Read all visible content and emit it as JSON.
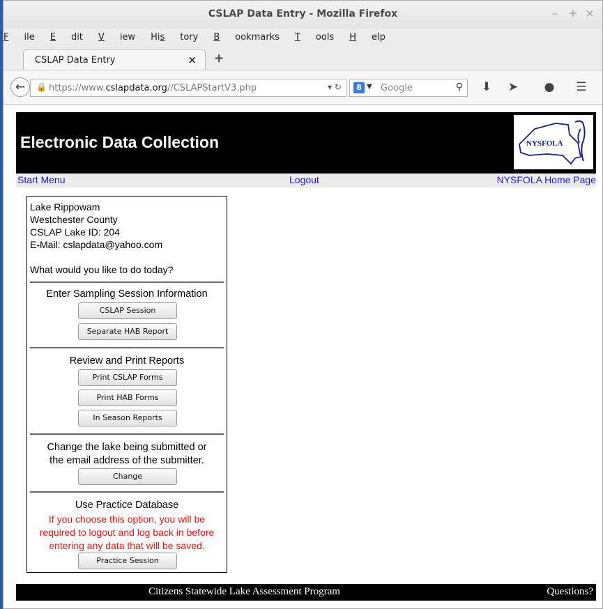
{
  "window": {
    "title": "CSLAP Data Entry - Mozilla Firefox",
    "minimize": "–",
    "maximize": "+",
    "close": "×"
  },
  "menu": [
    {
      "pre": "",
      "ul": "F",
      "post": "ile"
    },
    {
      "pre": "",
      "ul": "E",
      "post": "dit"
    },
    {
      "pre": "",
      "ul": "V",
      "post": "iew"
    },
    {
      "pre": "Hi",
      "ul": "s",
      "post": "tory"
    },
    {
      "pre": "",
      "ul": "B",
      "post": "ookmarks"
    },
    {
      "pre": "",
      "ul": "T",
      "post": "ools"
    },
    {
      "pre": "",
      "ul": "H",
      "post": "elp"
    }
  ],
  "tab": {
    "label": "CSLAP Data Entry",
    "close": "×",
    "new": "+"
  },
  "navbar": {
    "url_prefix": "https://www.",
    "url_domain": "cslapdata.org",
    "url_path": "//CSLAPStartV3.php",
    "search_engine_letter": "8",
    "search_placeholder": "Google"
  },
  "page": {
    "header_title": "Electronic Data Collection",
    "logo_text": "NYSFOLA",
    "nav": {
      "start": "Start Menu",
      "logout": "Logout",
      "home": "NYSFOLA Home Page"
    },
    "info": {
      "lake": "Lake Rippowam",
      "county": "Westchester County",
      "lake_id": "CSLAP Lake ID: 204",
      "email": "E-Mail: cslapdata@yahoo.com",
      "prompt": "What would you like to do today?"
    },
    "sections": {
      "sampling": {
        "heading": "Enter Sampling Session Information",
        "btn1": "CSLAP Session",
        "btn2": "Separate HAB Report"
      },
      "reports": {
        "heading": "Review and Print Reports",
        "btn1": "Print CSLAP Forms",
        "btn2": "Print HAB Forms",
        "btn3": "In Season Reports"
      },
      "change": {
        "line1": "Change the lake being submitted or",
        "line2": "the email address of the submitter.",
        "btn": "Change"
      },
      "practice": {
        "heading": "Use Practice Database",
        "warn1": "If you choose this option, you will be",
        "warn2": "required to logout and log back in before",
        "warn3": "entering any data that will be saved.",
        "btn": "Practice Session"
      }
    },
    "footer": {
      "program": "Citizens Statewide Lake Assessment Program",
      "questions": "Questions?"
    }
  }
}
